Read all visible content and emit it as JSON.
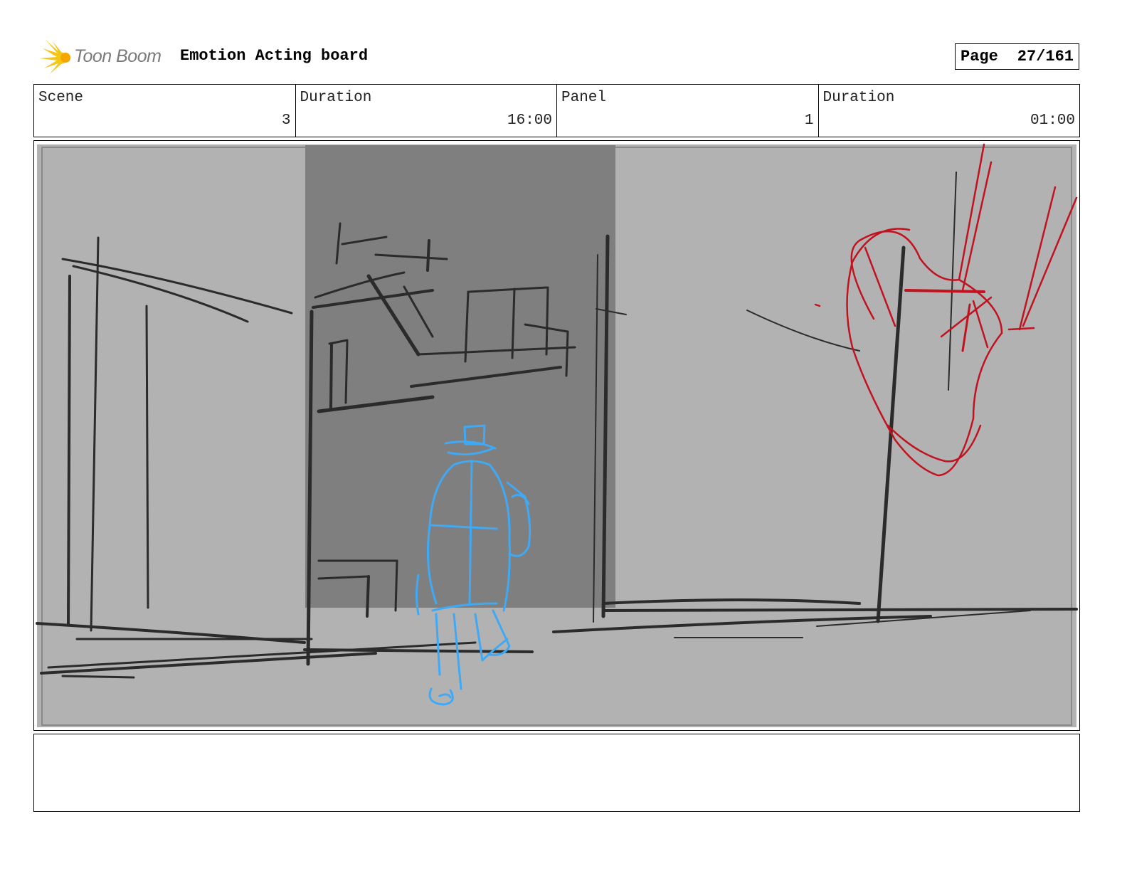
{
  "header": {
    "logo_text": "Toon Boom",
    "board_title": "Emotion Acting board",
    "page_label": "Page",
    "page_number": "27/161"
  },
  "info": {
    "scene_label": "Scene",
    "scene_value": "3",
    "scene_duration_label": "Duration",
    "scene_duration_value": "16:00",
    "panel_label": "Panel",
    "panel_value": "1",
    "panel_duration_label": "Duration",
    "panel_duration_value": "01:00"
  },
  "notes": {
    "text": ""
  },
  "colors": {
    "background": "#b2b2b2",
    "alley": "#7f7f7f",
    "ink": "#2b2b2b",
    "character": "#3fa9f5",
    "heart": "#c1121f",
    "logo_yellow": "#f5c518"
  },
  "icons": {
    "logo": "starburst-icon"
  }
}
